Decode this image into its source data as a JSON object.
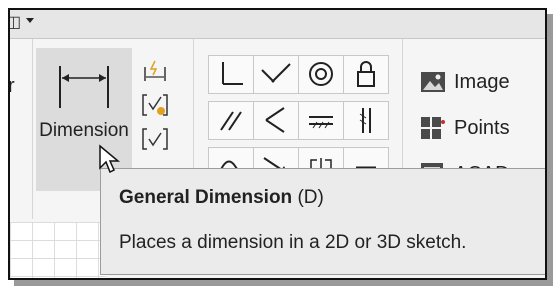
{
  "ribbon": {
    "dimension_button_label": "Dimension",
    "image_label": "Image",
    "points_label": "Points",
    "acad_label": "ACAD"
  },
  "tooltip": {
    "title": "General Dimension",
    "shortcut": "(D)",
    "description": "Places a dimension in a 2D or 3D sketch."
  },
  "icons": {
    "quick_access": "app-icon",
    "dimension": "dimension-icon",
    "cursor": "arrow-cursor"
  },
  "colors": {
    "ribbon_bg": "#f5f5f5",
    "tooltip_bg": "#ebebeb",
    "pressed_button": "#dcdcdc"
  }
}
